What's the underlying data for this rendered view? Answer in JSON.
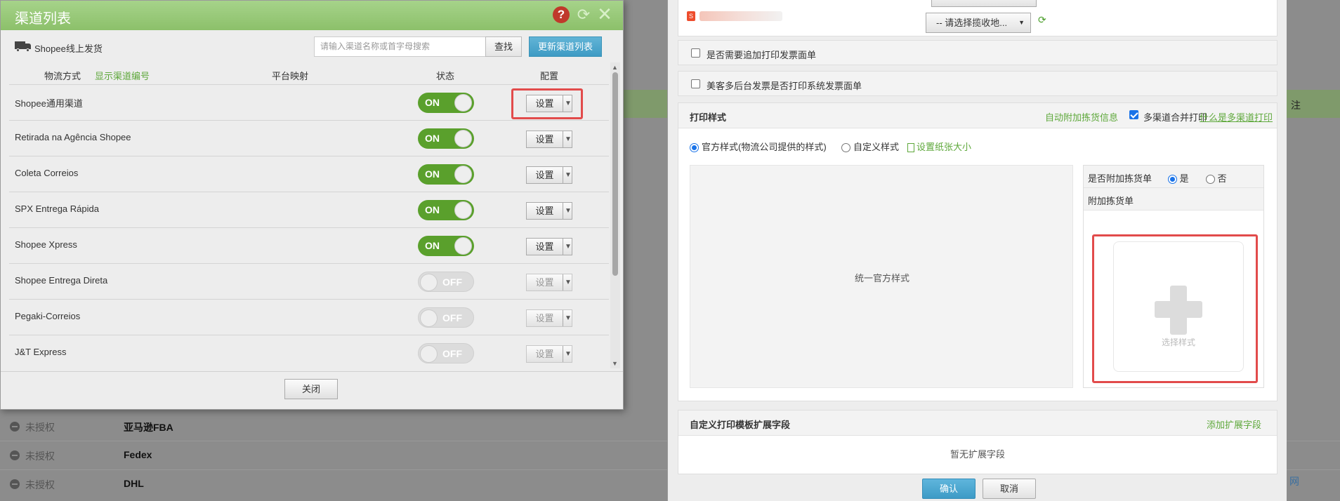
{
  "background": {
    "rows": [
      {
        "status": "未授权",
        "name": "亚马逊FBA"
      },
      {
        "status": "未授权",
        "name": "Fedex"
      },
      {
        "status": "未授权",
        "name": "DHL"
      }
    ],
    "edge_text": "注",
    "edge_text2": "网"
  },
  "left_modal": {
    "title": "渠道列表",
    "shop_label": "Shopee线上发货",
    "search_placeholder": "请输入渠道名称或首字母搜索",
    "search_button": "查找",
    "update_button": "更新渠道列表",
    "headers": {
      "method": "物流方式",
      "show_code": "显示渠道编号",
      "mapping": "平台映射",
      "status": "状态",
      "config": "配置"
    },
    "channels": [
      {
        "name": "Shopee通用渠道",
        "state": "ON",
        "config": "设置"
      },
      {
        "name": "Retirada na Agência Shopee",
        "state": "ON",
        "config": "设置"
      },
      {
        "name": "Coleta Correios",
        "state": "ON",
        "config": "设置"
      },
      {
        "name": "SPX Entrega Rápida",
        "state": "ON",
        "config": "设置"
      },
      {
        "name": "Shopee Xpress",
        "state": "ON",
        "config": "设置"
      },
      {
        "name": "Shopee Entrega Direta",
        "state": "OFF",
        "config": "设置"
      },
      {
        "name": "Pegaki-Correios",
        "state": "OFF",
        "config": "设置"
      },
      {
        "name": "J&T Express",
        "state": "OFF",
        "config": "设置"
      }
    ],
    "close_button": "关闭"
  },
  "right_modal": {
    "pickup_select": "-- 请选择揽收地...",
    "check_invoice": "是否需要追加打印发票面单",
    "check_meike": "美客多后台发票是否打印系统发票面单",
    "print_style": {
      "title": "打印样式",
      "auto_pick": "自动附加拣货信息",
      "multi_merge": "多渠道合并打印",
      "what_is_multi": "什么是多渠道打印",
      "official_style": "官方样式(物流公司提供的样式)",
      "custom_style": "自定义样式",
      "paper_size": "设置纸张大小",
      "preview_label": "统一官方样式",
      "attach_question": "是否附加拣货单",
      "yes": "是",
      "no": "否",
      "attach_label": "附加拣货单",
      "choose_style": "选择样式"
    },
    "ext_fields": {
      "title": "自定义打印模板扩展字段",
      "add": "添加扩展字段",
      "empty": "暂无扩展字段"
    },
    "ok_button": "确认",
    "cancel_button": "取消"
  },
  "colors": {
    "title_green": "#8cc06a",
    "toggle_on": "#5aa02c",
    "link_green": "#5ea83b",
    "primary_blue": "#3e9bc4",
    "highlight_red": "#e24b4b"
  }
}
